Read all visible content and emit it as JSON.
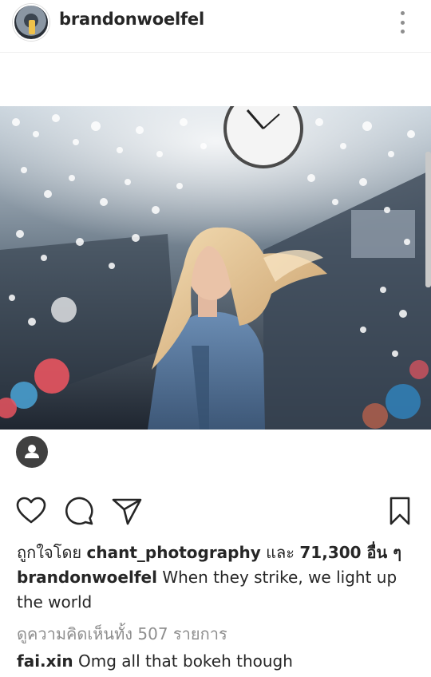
{
  "post": {
    "username": "brandonwoelfel",
    "more_icon": "more-vertical-icon",
    "photo": {
      "alt": ""
    },
    "user_tag_icon": "person-icon"
  },
  "actions": {
    "like_icon": "heart-icon",
    "comment_icon": "comment-bubble-icon",
    "share_icon": "paper-plane-icon",
    "save_icon": "bookmark-icon"
  },
  "likes": {
    "prefix": "ถูกใจโดย ",
    "user": "chant_photography",
    "middle": " และ ",
    "count": "71,300",
    "suffix": " อื่น ๆ"
  },
  "caption": {
    "user": "brandonwoelfel",
    "text": "When they strike, we light up the world"
  },
  "view_comments": "ดูความคิดเห็นทั้ง 507 รายการ",
  "comment": {
    "user": "fai.xin",
    "text": "Omg all that bokeh though"
  },
  "colors": {
    "text": "#262626",
    "muted": "#8e8e8e",
    "divider": "#efefef"
  }
}
